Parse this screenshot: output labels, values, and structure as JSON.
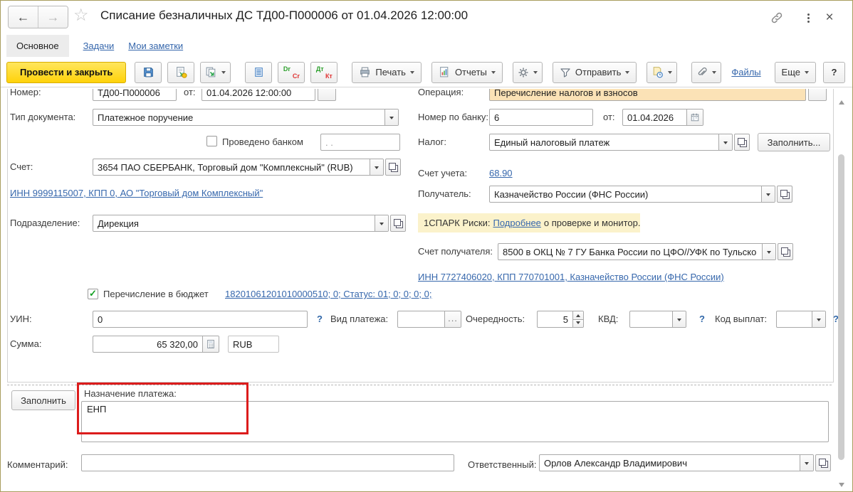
{
  "window": {
    "title": "Списание безналичных ДС ТД00-П000006 от 01.04.2026 12:00:00"
  },
  "icons": {
    "back": "←",
    "forward": "→",
    "star": "☆",
    "close": "×",
    "check": "✓"
  },
  "tabs": [
    {
      "label": "Основное",
      "active": true
    },
    {
      "label": "Задачи",
      "active": false
    },
    {
      "label": "Мои заметки",
      "active": false
    }
  ],
  "toolbar": {
    "post_and_close": "Провести и закрыть",
    "dr": "Dr",
    "cr": "Cr",
    "dt": "Дт",
    "kt": "Кт",
    "print": "Печать",
    "reports": "Отчеты",
    "send": "Отправить",
    "files": "Файлы",
    "more": "Еще",
    "help": "?"
  },
  "form": {
    "number": {
      "label": "Номер:",
      "value": "ТД00-П000006",
      "date_label": "от:",
      "date_value": "01.04.2026 12:00:00"
    },
    "operation": {
      "label": "Операция:",
      "value": "Перечисление налогов и взносов"
    },
    "doc_type": {
      "label": "Тип документа:",
      "value": "Платежное поручение"
    },
    "bank_number": {
      "label": "Номер по банку:",
      "value": "6",
      "date_label": "от:",
      "date_value": "01.04.2026"
    },
    "bank_posted": {
      "label": "Проведено банком",
      "date_value": ". ."
    },
    "tax": {
      "label": "Налог:",
      "value": "Единый налоговый платеж",
      "fill_button": "Заполнить..."
    },
    "account": {
      "label": "Счет:",
      "value": "3654 ПАО СБЕРБАНК, Торговый дом \"Комплексный\" (RUB)"
    },
    "payer_inn_link": "ИНН 9999115007, КПП 0, АО \"Торговый дом Комплексный\"",
    "accounting_account": {
      "label": "Счет учета:",
      "value": "68.90"
    },
    "payee": {
      "label": "Получатель:",
      "value": "Казначейство России (ФНС России)"
    },
    "department": {
      "label": "Подразделение:",
      "value": "Дирекция"
    },
    "spark": {
      "prefix": "1СПАРК Риски:",
      "link": "Подробнее",
      "suffix": "о проверке и монитор..."
    },
    "payee_account": {
      "label": "Счет получателя:",
      "value": "8500 в ОКЦ № 7 ГУ Банка России по ЦФО//УФК по Тульско"
    },
    "payee_inn_link": "ИНН 7727406020, КПП 770701001, Казначейство России (ФНС России)",
    "budget": {
      "label": "Перечисление в бюджет",
      "link": "18201061201010000510; 0; Статус: 01; 0; 0; 0; 0;"
    },
    "uin": {
      "label": "УИН:",
      "value": "0",
      "help": "?"
    },
    "payment_kind": {
      "label": "Вид платежа:",
      "value": "",
      "more_button": "..."
    },
    "priority": {
      "label": "Очередность:",
      "value": "5"
    },
    "kvd": {
      "label": "КВД:",
      "value": "",
      "help": "?"
    },
    "payout_code": {
      "label": "Код выплат:",
      "value": "",
      "help": "?"
    },
    "amount": {
      "label": "Сумма:",
      "value": "65 320,00",
      "currency": "RUB"
    }
  },
  "bottom": {
    "fill_button": "Заполнить",
    "purpose": {
      "label": "Назначение платежа:",
      "value": "ЕНП"
    },
    "comment": {
      "label": "Комментарий:",
      "value": ""
    },
    "responsible": {
      "label": "Ответственный:",
      "value": "Орлов Александр Владимирович"
    }
  }
}
